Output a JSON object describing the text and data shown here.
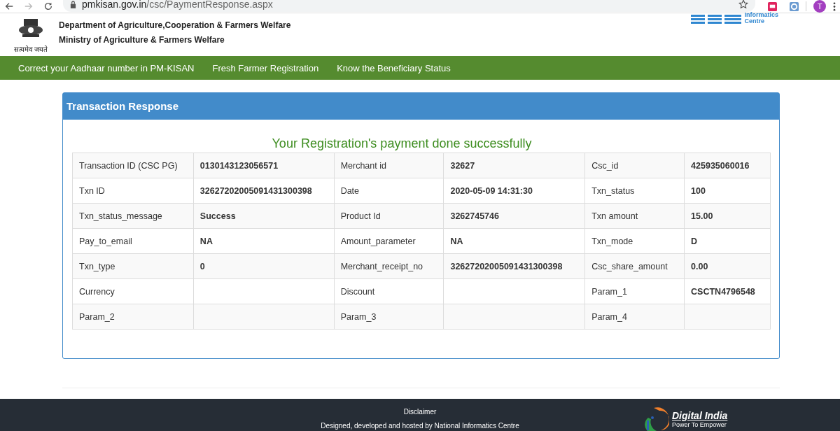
{
  "browser": {
    "url_host": "pmkisan.gov.in",
    "url_path": "/csc/PaymentResponse.aspx",
    "avatar": "T"
  },
  "header": {
    "emblem_caption": "सत्यमेव जयते",
    "lines": [
      "Department of Agriculture,Cooperation & Farmers Welfare",
      "Ministry of Agriculture & Farmers Welfare"
    ],
    "nic_lines": [
      "Informatics",
      "Centre"
    ]
  },
  "nav": [
    "Correct your Aadhaar number in PM-KISAN",
    "Fresh Farmer Registration",
    "Know the Beneficiary Status"
  ],
  "panel": {
    "title": "Transaction Response",
    "message": "Your Registration's payment done successfully"
  },
  "table": {
    "rows": [
      [
        "Transaction ID (CSC PG)",
        "0130143123056571",
        "Merchant id",
        "32627",
        "Csc_id",
        "425935060016"
      ],
      [
        "Txn ID",
        "32627202005091431300398",
        "Date",
        "2020-05-09 14:31:30",
        "Txn_status",
        "100"
      ],
      [
        "Txn_status_message",
        "Success",
        "Product Id",
        "3262745746",
        "Txn amount",
        "15.00"
      ],
      [
        "Pay_to_email",
        "NA",
        "Amount_parameter",
        "NA",
        "Txn_mode",
        "D"
      ],
      [
        "Txn_type",
        "0",
        "Merchant_receipt_no",
        "32627202005091431300398",
        "Csc_share_amount",
        "0.00"
      ],
      [
        "Currency",
        "",
        "Discount",
        "",
        "Param_1",
        "CSCTN4796548"
      ],
      [
        "Param_2",
        "",
        "Param_3",
        "",
        "Param_4",
        ""
      ]
    ]
  },
  "footer": {
    "disclaimer": "Disclaimer",
    "credit": "Designed, developed and hosted by National Informatics Centre",
    "logo_title": "Digital India",
    "logo_tagline": "Power To Empower"
  }
}
